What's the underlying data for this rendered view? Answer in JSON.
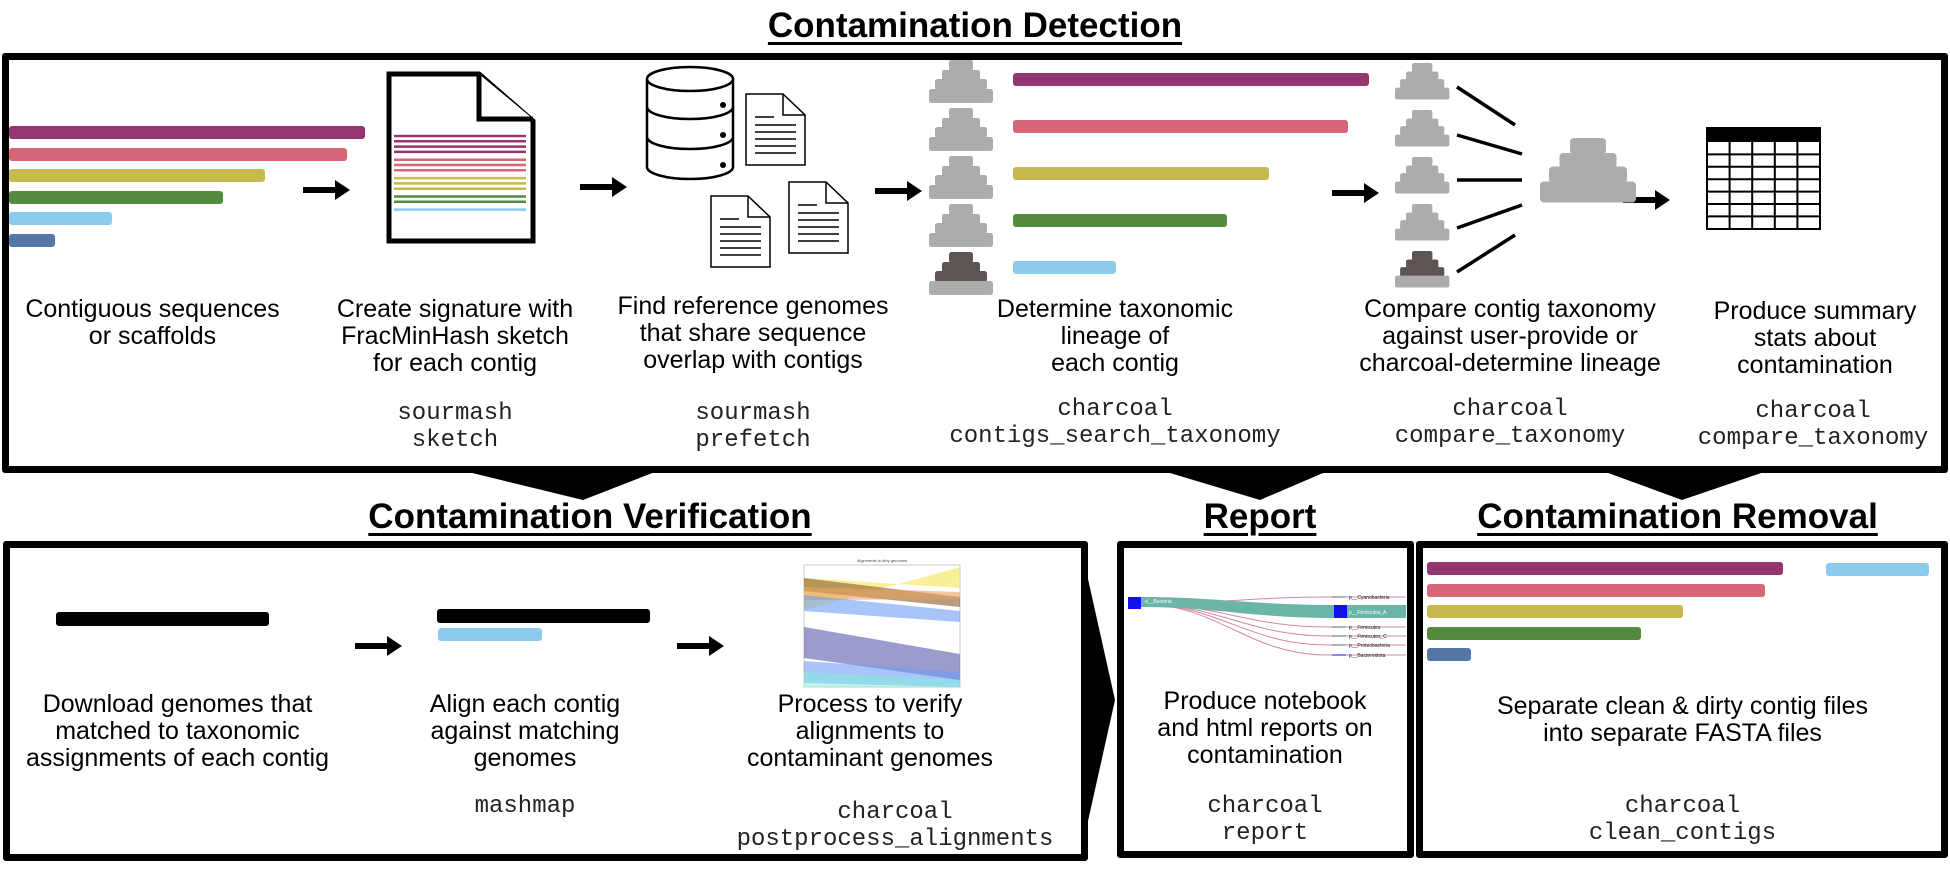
{
  "colors": {
    "purple": "#943670",
    "pink": "#d46677",
    "olive": "#c7b94e",
    "green": "#548a3d",
    "light_blue": "#8ccbeb",
    "steel_blue": "#5776a8",
    "gray": "#acacac",
    "dark_gray": "#5e5454",
    "teal": "#6ab5a6",
    "node_blue": "#1010ee",
    "link_pink": "#c76a8a"
  },
  "sections": {
    "detection": {
      "title": "Contamination Detection",
      "steps": [
        {
          "description": "Contiguous sequences\nor scaffolds",
          "command": ""
        },
        {
          "description": "Create signature with\nFracMinHash sketch\nfor each contig",
          "command": "sourmash\nsketch"
        },
        {
          "description": "Find reference genomes\nthat share sequence\noverlap with contigs",
          "command": "sourmash\nprefetch"
        },
        {
          "description": "Determine taxonomic\nlineage of\neach contig",
          "command": "charcoal\ncontigs_search_taxonomy"
        },
        {
          "description": "Compare contig taxonomy\nagainst user-provide or\ncharcoal-determine lineage",
          "command": "charcoal\ncompare_taxonomy"
        },
        {
          "description": "Produce summary\nstats about\ncontamination",
          "command": "charcoal\ncompare_taxonomy"
        }
      ]
    },
    "verification": {
      "title": "Contamination Verification",
      "steps": [
        {
          "description": "Download genomes that\nmatched to taxonomic\nassignments of each contig",
          "command": ""
        },
        {
          "description": "Align each contig\nagainst matching\ngenomes",
          "command": "mashmap"
        },
        {
          "description": "Process to verify\nalignments to\ncontaminant genomes",
          "command": "charcoal\npostprocess_alignments"
        }
      ],
      "thumbnail_title": "Alignments to dirty genomes"
    },
    "report": {
      "title": "Report",
      "description": "Produce notebook\nand html reports on\ncontamination",
      "command": "charcoal\nreport",
      "sankey": {
        "source": "d__Bacteria",
        "targets": [
          "p__Cyanobacteria",
          "p__Firmicutes_A",
          "p__Firmicutes",
          "p__Firmicutes_C",
          "p__Proteobacteria",
          "p__Bacteroidota"
        ]
      }
    },
    "removal": {
      "title": "Contamination Removal",
      "description": "Separate clean & dirty contig files\ninto separate FASTA files",
      "command": "charcoal\nclean_contigs"
    }
  },
  "contigs": {
    "relative_lengths": [
      1.0,
      0.95,
      0.72,
      0.6,
      0.29,
      0.13
    ],
    "color_keys": [
      "purple",
      "pink",
      "olive",
      "green",
      "light_blue",
      "steel_blue"
    ]
  }
}
